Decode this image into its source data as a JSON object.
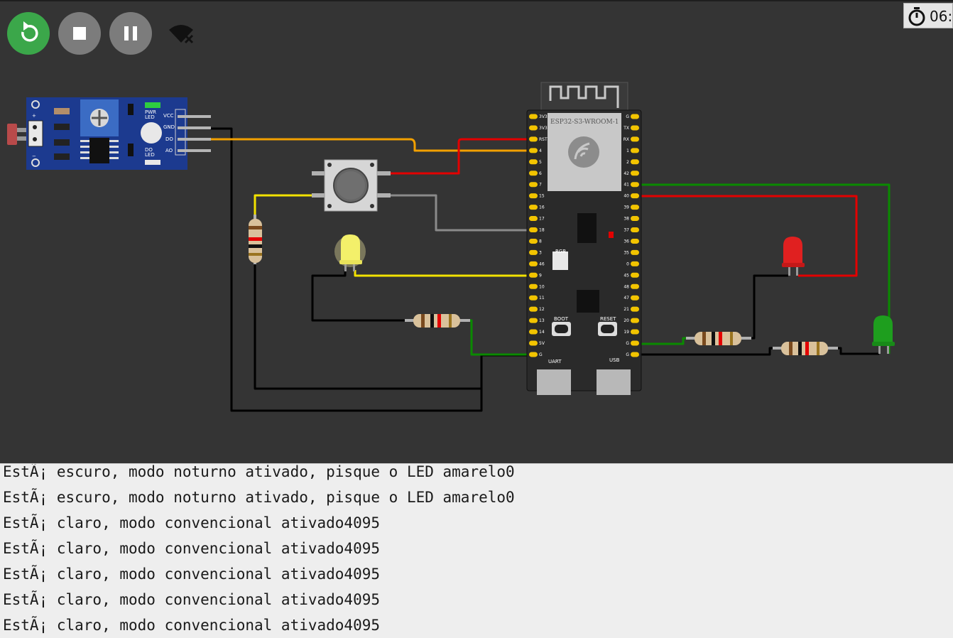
{
  "toolbar": {
    "restart_icon": "restart-icon",
    "stop_icon": "stop-icon",
    "pause_icon": "pause-icon",
    "wifi_icon": "wifi-off-icon",
    "timer_icon": "stopwatch-icon",
    "timer_text": "06:"
  },
  "sensor": {
    "pwr_led_label": "PWR\nLED",
    "pin_labels": [
      "VCC",
      "GND",
      "DO",
      "AO"
    ],
    "do_led_label": "DO\nLED",
    "plus": "+",
    "minus": "−"
  },
  "board": {
    "module_name": "ESP32-S3-WROOM-1",
    "left_pins": [
      "3V3",
      "3V3",
      "RST",
      "4",
      "5",
      "6",
      "7",
      "15",
      "16",
      "17",
      "18",
      "8",
      "3",
      "46",
      "9",
      "10",
      "11",
      "12",
      "13",
      "14",
      "5V",
      "G"
    ],
    "right_pins": [
      "G",
      "TX",
      "RX",
      "1",
      "2",
      "42",
      "41",
      "40",
      "39",
      "38",
      "37",
      "36",
      "35",
      "0",
      "45",
      "48",
      "47",
      "21",
      "20",
      "19",
      "G",
      "G"
    ],
    "rgb_label": "RGB",
    "boot_label": "BOOT",
    "reset_label": "RESET",
    "uart_label": "UART",
    "usb_label": "USB"
  },
  "colors": {
    "wire_red": "#e30000",
    "wire_orange": "#f2a000",
    "wire_yellow": "#f2e200",
    "wire_green": "#0a8a00",
    "wire_gray": "#8a8a8a",
    "wire_black": "#000000",
    "restart_green": "#3ba74a"
  },
  "console": {
    "lines": [
      "EstÃ¡ escuro, modo noturno ativado, pisque o LED amarelo0",
      "EstÃ¡ escuro, modo noturno ativado, pisque o LED amarelo0",
      "EstÃ¡ claro, modo convencional ativado4095",
      "EstÃ¡ claro, modo convencional ativado4095",
      "EstÃ¡ claro, modo convencional ativado4095",
      "EstÃ¡ claro, modo convencional ativado4095",
      "EstÃ¡ claro, modo convencional ativado4095"
    ]
  }
}
